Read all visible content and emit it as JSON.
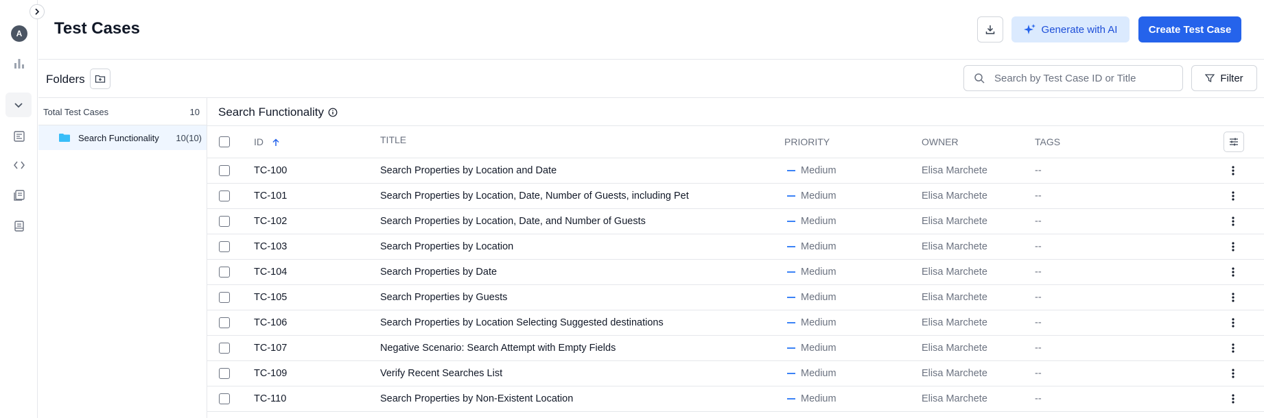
{
  "app": {
    "avatar_initial": "A"
  },
  "header": {
    "title": "Test Cases",
    "ai_button_label": "Generate with AI",
    "create_button_label": "Create Test Case"
  },
  "toolbar": {
    "folders_label": "Folders",
    "search_placeholder": "Search by Test Case ID or Title",
    "filter_label": "Filter"
  },
  "folders": {
    "total_label": "Total Test Cases",
    "total_count": "10",
    "items": [
      {
        "label": "Search Functionality",
        "count": "10(10)"
      }
    ]
  },
  "main": {
    "section_title": "Search Functionality",
    "columns": {
      "id": "ID",
      "title": "TITLE",
      "priority": "PRIORITY",
      "owner": "OWNER",
      "tags": "TAGS"
    },
    "rows": [
      {
        "id": "TC-100",
        "title": "Search Properties by Location and Date",
        "priority": "Medium",
        "owner": "Elisa Marchete",
        "tags": "--"
      },
      {
        "id": "TC-101",
        "title": "Search Properties by Location, Date, Number of Guests, including Pet",
        "priority": "Medium",
        "owner": "Elisa Marchete",
        "tags": "--"
      },
      {
        "id": "TC-102",
        "title": "Search Properties by Location, Date, and Number of Guests",
        "priority": "Medium",
        "owner": "Elisa Marchete",
        "tags": "--"
      },
      {
        "id": "TC-103",
        "title": "Search Properties by Location",
        "priority": "Medium",
        "owner": "Elisa Marchete",
        "tags": "--"
      },
      {
        "id": "TC-104",
        "title": "Search Properties by Date",
        "priority": "Medium",
        "owner": "Elisa Marchete",
        "tags": "--"
      },
      {
        "id": "TC-105",
        "title": "Search Properties by Guests",
        "priority": "Medium",
        "owner": "Elisa Marchete",
        "tags": "--"
      },
      {
        "id": "TC-106",
        "title": "Search Properties by Location Selecting Suggested destinations",
        "priority": "Medium",
        "owner": "Elisa Marchete",
        "tags": "--"
      },
      {
        "id": "TC-107",
        "title": "Negative Scenario: Search Attempt with Empty Fields",
        "priority": "Medium",
        "owner": "Elisa Marchete",
        "tags": "--"
      },
      {
        "id": "TC-109",
        "title": "Verify Recent Searches List",
        "priority": "Medium",
        "owner": "Elisa Marchete",
        "tags": "--"
      },
      {
        "id": "TC-110",
        "title": "Search Properties by Non-Existent Location",
        "priority": "Medium",
        "owner": "Elisa Marchete",
        "tags": "--"
      }
    ]
  },
  "colors": {
    "accent": "#2563eb",
    "accent_light": "#dbeafe",
    "folder": "#38bdf8",
    "priority_medium": "#3b82f6"
  }
}
